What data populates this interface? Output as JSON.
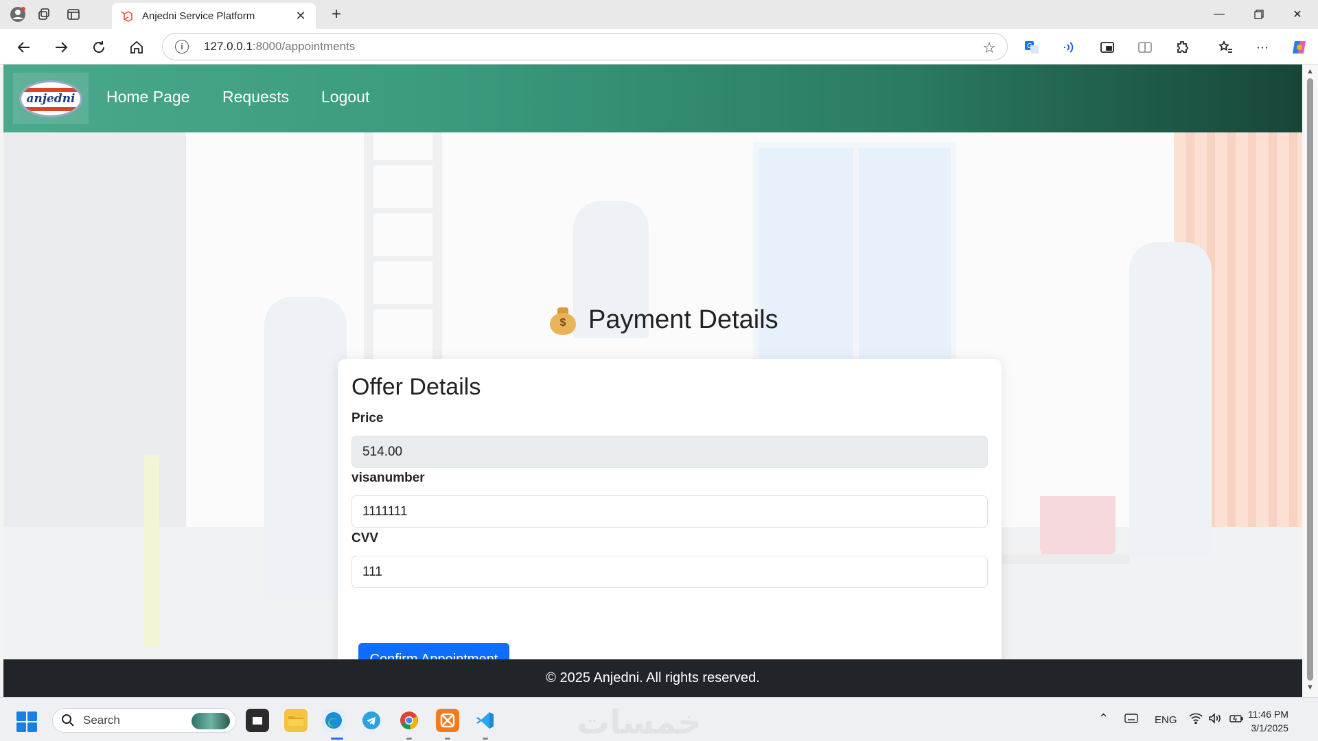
{
  "browser": {
    "tab_title": "Anjedni Service Platform",
    "url_host": "127.0.0.1",
    "url_path": ":8000/appointments"
  },
  "site": {
    "logo_text": "anjedni",
    "nav": [
      "Home Page",
      "Requests",
      "Logout"
    ],
    "footer": "© 2025 Anjedni. All rights reserved."
  },
  "payment": {
    "heading": "Payment Details",
    "card_title": "Offer Details",
    "price_label": "Price",
    "price_value": "514.00",
    "visa_label": "visanumber",
    "visa_value": "1111111",
    "cvv_label": "CVV",
    "cvv_value": "111",
    "confirm_label": "Confirm Appointment"
  },
  "taskbar": {
    "search_placeholder": "Search",
    "language": "ENG",
    "time": "11:46 PM",
    "date": "3/1/2025",
    "watermark": "خمسات"
  },
  "colors": {
    "navbar_start": "#4aa98c",
    "navbar_end": "#174638",
    "primary_button": "#0d6efd",
    "footer": "#212529"
  }
}
